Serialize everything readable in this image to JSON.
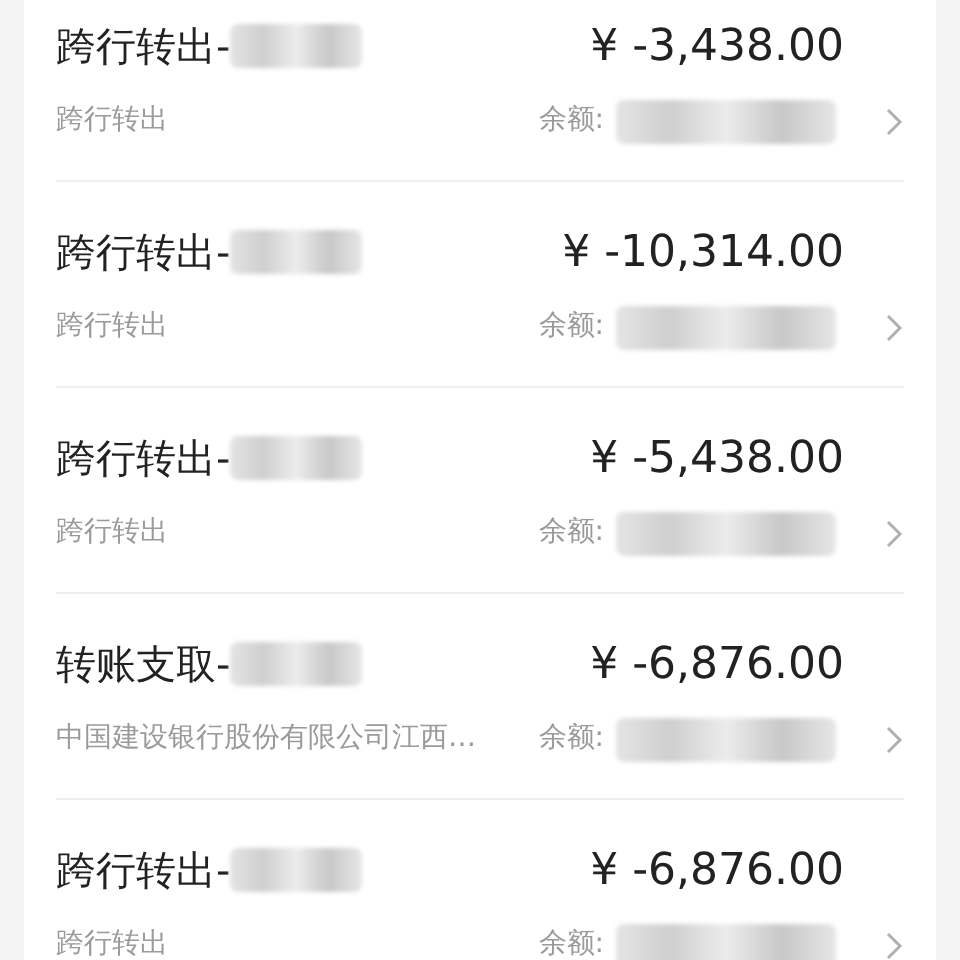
{
  "transactions": [
    {
      "title": "跨行转出-",
      "amount": "¥ -3,438.00",
      "subtitle": "跨行转出",
      "balance_label": "余额:"
    },
    {
      "title": "跨行转出-",
      "amount": "¥ -10,314.00",
      "subtitle": "跨行转出",
      "balance_label": "余额:"
    },
    {
      "title": "跨行转出-",
      "amount": "¥ -5,438.00",
      "subtitle": "跨行转出",
      "balance_label": "余额:"
    },
    {
      "title": "转账支取-",
      "amount": "¥ -6,876.00",
      "subtitle": "中国建设银行股份有限公司江西…",
      "balance_label": "余额:"
    },
    {
      "title": "跨行转出-",
      "amount": "¥ -6,876.00",
      "subtitle": "跨行转出",
      "balance_label": "余额:"
    }
  ]
}
